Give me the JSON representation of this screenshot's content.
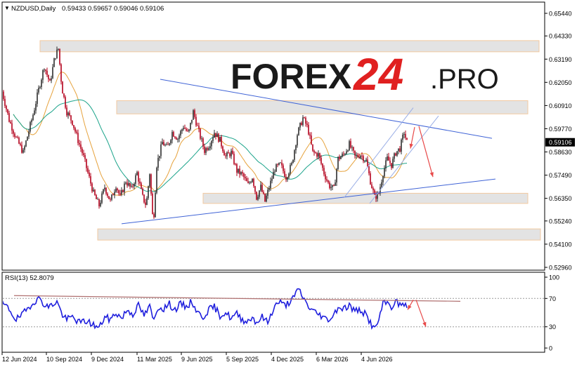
{
  "header": {
    "symbol": "NZDUSD,Daily",
    "ohlc": "0.59433 0.59657 0.59046 0.59106"
  },
  "logo": {
    "brand": "FOREX",
    "number": "24",
    "suffix": ".PRO"
  },
  "colors": {
    "bull": "#2e2e2e",
    "bear": "#b3001b",
    "ma_fast": "#e6a23c",
    "ma_slow": "#1aa38a",
    "trendline": "#3f63d6",
    "channel": "#9aaee6",
    "arrow": "#e84a4a",
    "zone_fill": "#e3e3e3",
    "zone_border": "#f2c9a0",
    "rsi": "#1f1fdd",
    "rsi_trend": "#b07070"
  },
  "price_axis": {
    "ticks": [
      "0.65440",
      "0.64330",
      "0.63190",
      "0.62050",
      "0.60910",
      "0.59770",
      "0.58630",
      "0.57490",
      "0.56350",
      "0.55240",
      "0.54100",
      "0.52960"
    ],
    "current": "0.59106"
  },
  "rsi": {
    "label": "RSI(13) 52.8079",
    "ticks": [
      "100",
      "70",
      "30",
      "0"
    ],
    "levels": [
      70,
      30
    ]
  },
  "time_axis": [
    "12 Jun 2024",
    "10 Sep 2024",
    "9 Dec 2024",
    "11 Mar 2025",
    "9 Jun 2025",
    "5 Sep 2025",
    "4 Dec 2025",
    "6 Mar 2026",
    "4 Jun 2026"
  ],
  "chart_data": {
    "type": "candlestick",
    "ylim": [
      0.5296,
      0.6544
    ],
    "zones": [
      [
        0.6355,
        0.641
      ],
      [
        0.605,
        0.6115
      ],
      [
        0.561,
        0.566
      ],
      [
        0.543,
        0.5485
      ]
    ],
    "keypoints": [
      [
        0,
        0.616
      ],
      [
        10,
        0.602
      ],
      [
        20,
        0.593
      ],
      [
        30,
        0.586
      ],
      [
        45,
        0.606
      ],
      [
        52,
        0.617
      ],
      [
        60,
        0.6285
      ],
      [
        68,
        0.62
      ],
      [
        75,
        0.633
      ],
      [
        80,
        0.637
      ],
      [
        85,
        0.618
      ],
      [
        92,
        0.606
      ],
      [
        100,
        0.601
      ],
      [
        108,
        0.592
      ],
      [
        115,
        0.585
      ],
      [
        122,
        0.576
      ],
      [
        130,
        0.566
      ],
      [
        138,
        0.56
      ],
      [
        146,
        0.569
      ],
      [
        154,
        0.562
      ],
      [
        162,
        0.57
      ],
      [
        168,
        0.564
      ],
      [
        176,
        0.572
      ],
      [
        184,
        0.568
      ],
      [
        192,
        0.576
      ],
      [
        200,
        0.564
      ],
      [
        205,
        0.56
      ],
      [
        210,
        0.576
      ],
      [
        215,
        0.55
      ],
      [
        220,
        0.58
      ],
      [
        228,
        0.591
      ],
      [
        235,
        0.588
      ],
      [
        242,
        0.596
      ],
      [
        250,
        0.593
      ],
      [
        258,
        0.599
      ],
      [
        265,
        0.595
      ],
      [
        272,
        0.606
      ],
      [
        280,
        0.596
      ],
      [
        288,
        0.587
      ],
      [
        295,
        0.59
      ],
      [
        302,
        0.596
      ],
      [
        310,
        0.592
      ],
      [
        318,
        0.584
      ],
      [
        326,
        0.586
      ],
      [
        334,
        0.577
      ],
      [
        342,
        0.575
      ],
      [
        350,
        0.57
      ],
      [
        356,
        0.574
      ],
      [
        362,
        0.564
      ],
      [
        368,
        0.569
      ],
      [
        374,
        0.562
      ],
      [
        380,
        0.569
      ],
      [
        388,
        0.578
      ],
      [
        396,
        0.58
      ],
      [
        404,
        0.574
      ],
      [
        412,
        0.58
      ],
      [
        420,
        0.595
      ],
      [
        428,
        0.603
      ],
      [
        435,
        0.598
      ],
      [
        442,
        0.586
      ],
      [
        450,
        0.585
      ],
      [
        458,
        0.576
      ],
      [
        465,
        0.57
      ],
      [
        472,
        0.568
      ],
      [
        478,
        0.583
      ],
      [
        486,
        0.585
      ],
      [
        494,
        0.59
      ],
      [
        502,
        0.584
      ],
      [
        510,
        0.585
      ],
      [
        518,
        0.582
      ],
      [
        524,
        0.572
      ],
      [
        530,
        0.564
      ],
      [
        536,
        0.566
      ],
      [
        542,
        0.576
      ],
      [
        548,
        0.583
      ],
      [
        554,
        0.58
      ],
      [
        560,
        0.586
      ],
      [
        566,
        0.588
      ],
      [
        572,
        0.596
      ],
      [
        576,
        0.591
      ]
    ],
    "ma_offsets": {
      "fast": 0.006,
      "slow": 0.012
    },
    "trendlines": [
      [
        [
          228,
          0.622
        ],
        [
          700,
          0.593
        ]
      ],
      [
        [
          173,
          0.551
        ],
        [
          705,
          0.573
        ]
      ]
    ],
    "channel_lines": [
      [
        [
          490,
          0.564
        ],
        [
          588,
          0.608
        ]
      ],
      [
        [
          526,
          0.561
        ],
        [
          624,
          0.604
        ]
      ]
    ],
    "arrows": [
      [
        [
          596,
          0.599
        ],
        [
          616,
          0.574
        ]
      ],
      [
        [
          590,
          0.5985
        ],
        [
          584,
          0.588
        ]
      ]
    ],
    "rsi_values": [
      [
        0,
        63
      ],
      [
        10,
        55
      ],
      [
        20,
        40
      ],
      [
        30,
        48
      ],
      [
        45,
        66
      ],
      [
        55,
        70
      ],
      [
        62,
        58
      ],
      [
        70,
        60
      ],
      [
        78,
        66
      ],
      [
        85,
        48
      ],
      [
        92,
        40
      ],
      [
        100,
        44
      ],
      [
        110,
        36
      ],
      [
        120,
        38
      ],
      [
        128,
        34
      ],
      [
        138,
        28
      ],
      [
        146,
        44
      ],
      [
        154,
        40
      ],
      [
        162,
        50
      ],
      [
        170,
        42
      ],
      [
        178,
        54
      ],
      [
        186,
        48
      ],
      [
        194,
        60
      ],
      [
        202,
        46
      ],
      [
        210,
        58
      ],
      [
        216,
        38
      ],
      [
        222,
        58
      ],
      [
        230,
        56
      ],
      [
        238,
        62
      ],
      [
        246,
        54
      ],
      [
        254,
        62
      ],
      [
        262,
        58
      ],
      [
        270,
        66
      ],
      [
        278,
        50
      ],
      [
        286,
        44
      ],
      [
        294,
        54
      ],
      [
        302,
        58
      ],
      [
        310,
        46
      ],
      [
        318,
        50
      ],
      [
        326,
        42
      ],
      [
        334,
        48
      ],
      [
        342,
        40
      ],
      [
        350,
        38
      ],
      [
        356,
        44
      ],
      [
        362,
        36
      ],
      [
        370,
        44
      ],
      [
        378,
        36
      ],
      [
        386,
        56
      ],
      [
        394,
        66
      ],
      [
        402,
        60
      ],
      [
        410,
        66
      ],
      [
        416,
        72
      ],
      [
        422,
        84
      ],
      [
        430,
        68
      ],
      [
        438,
        56
      ],
      [
        446,
        50
      ],
      [
        454,
        46
      ],
      [
        462,
        40
      ],
      [
        470,
        44
      ],
      [
        478,
        58
      ],
      [
        486,
        56
      ],
      [
        494,
        60
      ],
      [
        502,
        52
      ],
      [
        510,
        54
      ],
      [
        518,
        46
      ],
      [
        524,
        36
      ],
      [
        530,
        26
      ],
      [
        536,
        40
      ],
      [
        542,
        62
      ],
      [
        548,
        64
      ],
      [
        554,
        58
      ],
      [
        560,
        66
      ],
      [
        566,
        60
      ],
      [
        572,
        64
      ],
      [
        576,
        53
      ]
    ],
    "rsi_trend": [
      [
        20,
        74
      ],
      [
        655,
        66
      ]
    ],
    "rsi_arrows": [
      [
        [
          592,
          68
        ],
        [
          606,
          30
        ]
      ],
      [
        [
          588,
          68
        ],
        [
          580,
          54
        ]
      ]
    ]
  }
}
